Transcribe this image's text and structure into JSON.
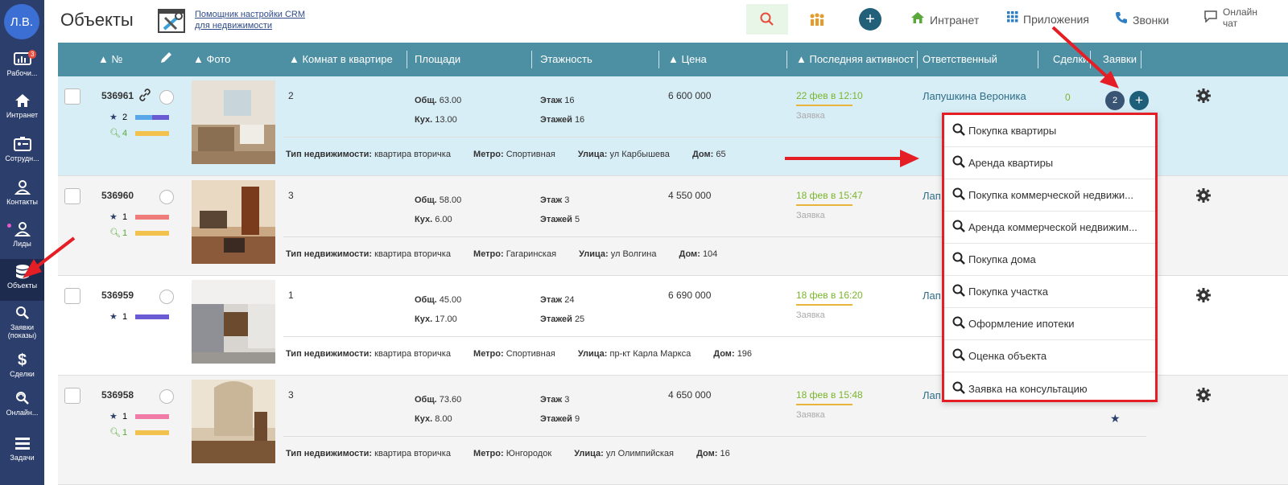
{
  "user": {
    "initials": "Л.В."
  },
  "sidebar": {
    "items": [
      {
        "label": "Рабочи...",
        "icon": "dashboard-icon",
        "badge": "3"
      },
      {
        "label": "Интранет",
        "icon": "home-icon"
      },
      {
        "label": "Сотрудн...",
        "icon": "employees-icon"
      },
      {
        "label": "Контакты",
        "icon": "contacts-icon"
      },
      {
        "label": "Лиды",
        "icon": "leads-icon"
      },
      {
        "label": "Объекты",
        "icon": "database-icon"
      },
      {
        "label": "Заявки (показы)",
        "icon": "search-icon"
      },
      {
        "label": "Сделки",
        "icon": "dollar-icon"
      },
      {
        "label": "Онлайн...",
        "icon": "online-search-icon"
      },
      {
        "label": "Задачи",
        "icon": "tasks-icon"
      }
    ]
  },
  "header": {
    "title": "Объекты",
    "helper_line1": "Помощник настройки CRM",
    "helper_line2": "для недвижимости",
    "intranet": "Интранет",
    "apps": "Приложения",
    "calls": "Звонки",
    "chat_line1": "Онлайн",
    "chat_line2": "чат"
  },
  "columns": {
    "num": "▲ №",
    "photo": "▲ Фото",
    "rooms": "▲ Комнат в квартире",
    "area": "Площади",
    "floor": "Этажность",
    "price": "▲ Цена",
    "activity": "▲ Последняя активност",
    "responsible": "Ответственный",
    "deals": "Сделки",
    "requests": "Заявки"
  },
  "labels": {
    "total": "Общ.",
    "kitchen": "Кух.",
    "floor": "Этаж",
    "floors": "Этажей",
    "property_type": "Тип недвижимости:",
    "metro": "Метро:",
    "street": "Улица:",
    "house": "Дом:",
    "request": "Заявка"
  },
  "rows": [
    {
      "id": "536961",
      "stars": "2",
      "searches": "4",
      "rooms": "2",
      "total_area": "63.00",
      "kitchen_area": "13.00",
      "floor": "16",
      "floors": "16",
      "price": "6 600 000",
      "activity": "22 фев в 12:10",
      "responsible": "Лапушкина Вероника",
      "deals": "0",
      "type": "квартира вторичка",
      "metro": "Спортивная",
      "street": "ул Карбышева",
      "house": "65"
    },
    {
      "id": "536960",
      "stars": "1",
      "searches": "1",
      "rooms": "3",
      "total_area": "58.00",
      "kitchen_area": "6.00",
      "floor": "3",
      "floors": "5",
      "price": "4 550 000",
      "activity": "18 фев в 15:47",
      "responsible": "Лап",
      "type": "квартира вторичка",
      "metro": "Гагаринская",
      "street": "ул Волгина",
      "house": "104"
    },
    {
      "id": "536959",
      "stars": "1",
      "rooms": "1",
      "total_area": "45.00",
      "kitchen_area": "17.00",
      "floor": "24",
      "floors": "25",
      "price": "6 690 000",
      "activity": "18 фев в 16:20",
      "responsible": "Лап",
      "type": "квартира вторичка",
      "metro": "Спортивная",
      "street": "пр-кт Карла Маркса",
      "house": "196"
    },
    {
      "id": "536958",
      "stars": "1",
      "searches": "1",
      "rooms": "3",
      "total_area": "73.60",
      "kitchen_area": "8.00",
      "floor": "3",
      "floors": "9",
      "price": "4 650 000",
      "activity": "18 фев в 15:48",
      "responsible": "Лап",
      "type": "квартира вторичка",
      "metro": "Юнгородок",
      "street": "ул Олимпийская",
      "house": "16"
    }
  ],
  "requests_count": "2",
  "dropdown": {
    "items": [
      "Покупка квартиры",
      "Аренда квартиры",
      "Покупка коммерческой недвижи...",
      "Аренда коммерческой недвижим...",
      "Покупка дома",
      "Покупка участка",
      "Оформление ипотеки",
      "Оценка объекта",
      "Заявка на консультацию"
    ]
  },
  "colors": {
    "accent": "#4d8fa3",
    "highlight": "#e51e26",
    "sidebar": "#2c3e6b"
  }
}
